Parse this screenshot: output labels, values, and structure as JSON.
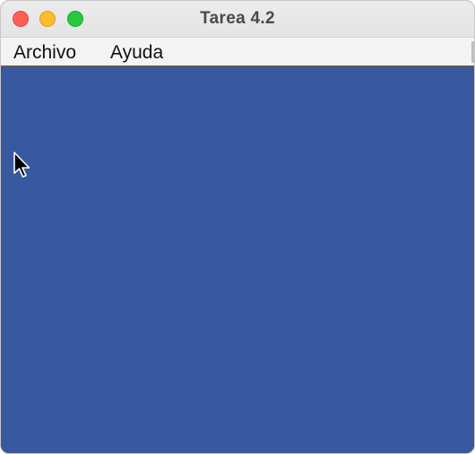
{
  "window": {
    "title": "Tarea 4.2"
  },
  "menubar": {
    "items": [
      {
        "label": "Archivo"
      },
      {
        "label": "Ayuda"
      }
    ]
  },
  "content": {
    "background_color": "#3858a0"
  },
  "icons": {
    "close": "close-icon",
    "minimize": "minimize-icon",
    "zoom": "zoom-icon",
    "cursor": "mouse-pointer-icon"
  }
}
